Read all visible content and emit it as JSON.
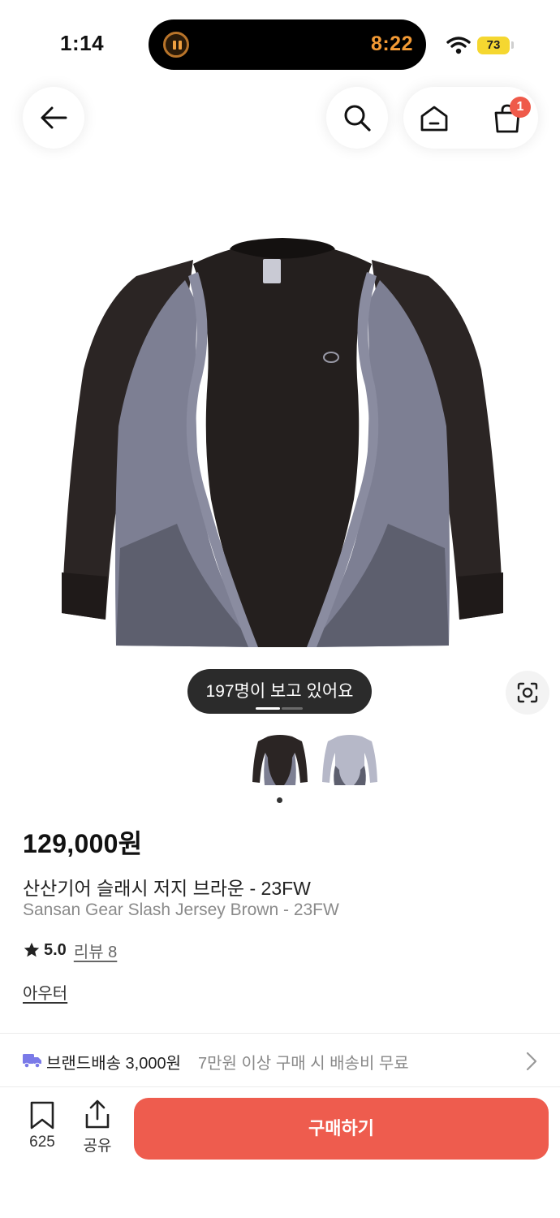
{
  "status_bar": {
    "time": "1:14",
    "activity_time": "8:22",
    "battery": "73",
    "icons": [
      "pause-icon",
      "wifi-icon",
      "battery-icon"
    ]
  },
  "header": {
    "back_icon": "arrow-left-icon",
    "search_icon": "search-icon",
    "home_icon": "home-icon",
    "cart_icon": "shopping-bag-icon",
    "cart_count": "1"
  },
  "gallery": {
    "viewers_text": "197명이 보고 있어요",
    "lens_icon": "visual-search-icon",
    "thumbnails": [
      "thumbnail-black-jersey",
      "thumbnail-gray-jersey"
    ]
  },
  "product": {
    "price": "129,000원",
    "name_kr": "산산기어 슬래시 저지 브라운 - 23FW",
    "name_en": "Sansan Gear Slash Jersey Brown - 23FW",
    "rating": "5.0",
    "review_text": "리뷰 8",
    "category": "아우터"
  },
  "shipping": {
    "icon": "truck-icon",
    "label": "브랜드배송 3,000원",
    "note": "7만원 이상 구매 시 배송비 무료"
  },
  "bottom_bar": {
    "bookmark_icon": "bookmark-icon",
    "bookmark_count": "625",
    "share_icon": "share-icon",
    "share_label": "공유",
    "buy_label": "구매하기"
  },
  "colors": {
    "accent": "#ee5c4e",
    "badge": "#ef5a4a",
    "activity": "#f39a35",
    "battery": "#f5d730"
  }
}
